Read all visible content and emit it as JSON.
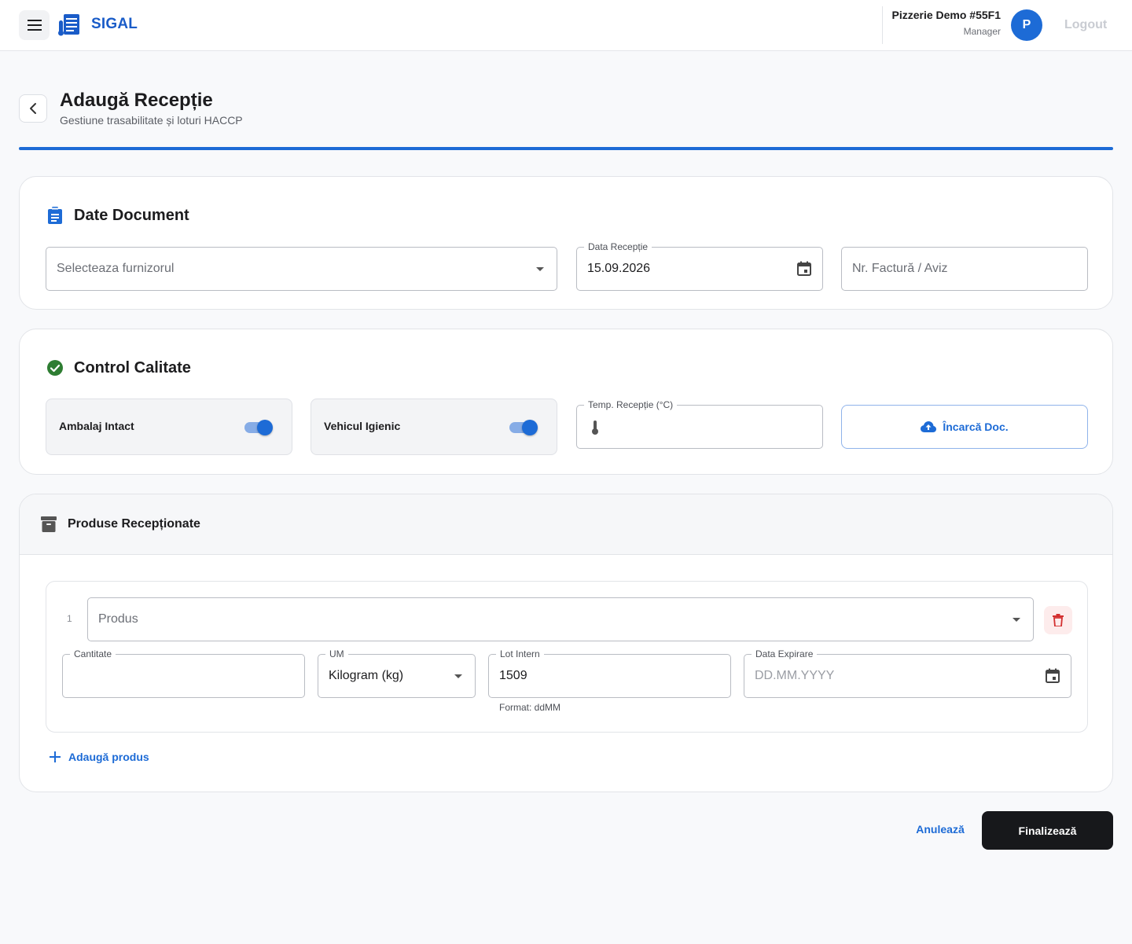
{
  "app": {
    "brand": "SIGAL",
    "user_name": "Pizzerie Demo #55F1",
    "user_role": "Manager",
    "avatar_letter": "P",
    "logout_label": "Logout"
  },
  "header": {
    "title": "Adaugă Recepție",
    "subtitle": "Gestiune trasabilitate și loturi HACCP"
  },
  "document_card": {
    "title": "Date Document",
    "supplier_placeholder": "Selecteaza furnizorul",
    "date_label": "Data Recepție",
    "date_value": "15.09.2026",
    "invoice_placeholder": "Nr. Factură / Aviz"
  },
  "quality_card": {
    "title": "Control Calitate",
    "toggles": [
      {
        "label": "Ambalaj Intact",
        "checked": true
      },
      {
        "label": "Vehicul Igienic",
        "checked": true
      }
    ],
    "temp_label": "Temp. Recepție (°C)",
    "temp_value": "",
    "upload_label": "Încarcă Doc."
  },
  "products_card": {
    "title": "Produse Recepționate",
    "items": [
      {
        "index": "1",
        "product_placeholder": "Produs",
        "quantity_label": "Cantitate",
        "quantity_value": "",
        "um_label": "UM",
        "um_value": "Kilogram (kg)",
        "lot_label": "Lot Intern",
        "lot_value": "1509",
        "lot_helper": "Format: ddMM",
        "expiry_label": "Data Expirare",
        "expiry_placeholder": "DD.MM.YYYY"
      }
    ],
    "add_label": "Adaugă produs"
  },
  "actions": {
    "cancel_label": "Anulează",
    "finish_label": "Finalizează"
  },
  "colors": {
    "accent": "#1d6bd6",
    "success": "#2e7d32",
    "danger": "#d32f2f",
    "dark_button": "#17181b"
  }
}
